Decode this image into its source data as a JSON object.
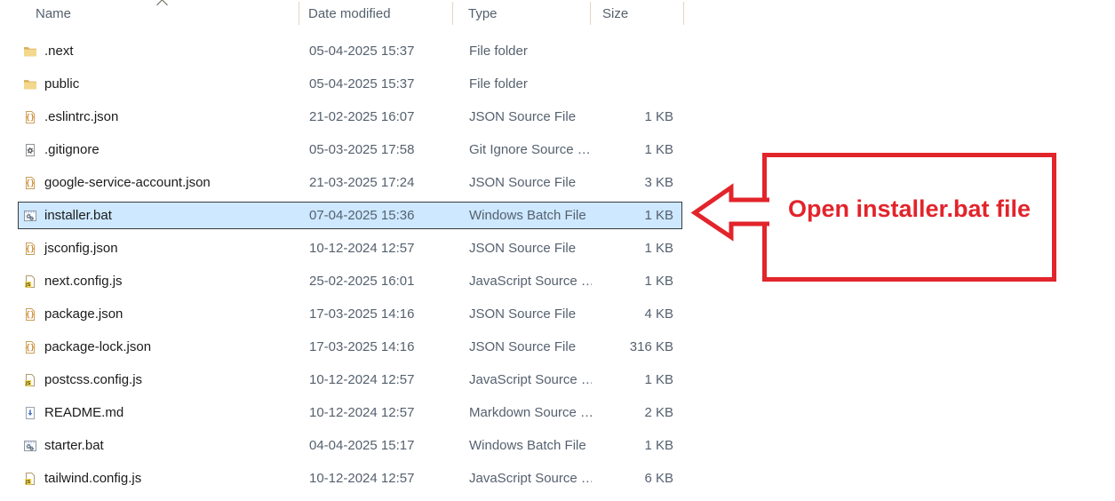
{
  "columns": {
    "name": "Name",
    "date_modified": "Date modified",
    "type": "Type",
    "size": "Size"
  },
  "sort": {
    "column": "Name",
    "direction": "ascending"
  },
  "files": [
    {
      "name": ".next",
      "date": "05-04-2025 15:37",
      "type": "File folder",
      "size": "",
      "icon": "folder-icon",
      "selected": false
    },
    {
      "name": "public",
      "date": "05-04-2025 15:37",
      "type": "File folder",
      "size": "",
      "icon": "folder-icon",
      "selected": false
    },
    {
      "name": ".eslintrc.json",
      "date": "21-02-2025 16:07",
      "type": "JSON Source File",
      "size": "1 KB",
      "icon": "json-icon",
      "selected": false
    },
    {
      "name": ".gitignore",
      "date": "05-03-2025 17:58",
      "type": "Git Ignore Source …",
      "size": "1 KB",
      "icon": "gitignore-icon",
      "selected": false
    },
    {
      "name": "google-service-account.json",
      "date": "21-03-2025 17:24",
      "type": "JSON Source File",
      "size": "3 KB",
      "icon": "json-icon",
      "selected": false
    },
    {
      "name": "installer.bat",
      "date": "07-04-2025 15:36",
      "type": "Windows Batch File",
      "size": "1 KB",
      "icon": "batch-icon",
      "selected": true
    },
    {
      "name": "jsconfig.json",
      "date": "10-12-2024 12:57",
      "type": "JSON Source File",
      "size": "1 KB",
      "icon": "json-icon",
      "selected": false
    },
    {
      "name": "next.config.js",
      "date": "25-02-2025 16:01",
      "type": "JavaScript Source …",
      "size": "1 KB",
      "icon": "js-icon",
      "selected": false
    },
    {
      "name": "package.json",
      "date": "17-03-2025 14:16",
      "type": "JSON Source File",
      "size": "4 KB",
      "icon": "json-icon",
      "selected": false
    },
    {
      "name": "package-lock.json",
      "date": "17-03-2025 14:16",
      "type": "JSON Source File",
      "size": "316 KB",
      "icon": "json-icon",
      "selected": false
    },
    {
      "name": "postcss.config.js",
      "date": "10-12-2024 12:57",
      "type": "JavaScript Source …",
      "size": "1 KB",
      "icon": "js-icon",
      "selected": false
    },
    {
      "name": "README.md",
      "date": "10-12-2024 12:57",
      "type": "Markdown Source …",
      "size": "2 KB",
      "icon": "markdown-icon",
      "selected": false
    },
    {
      "name": "starter.bat",
      "date": "04-04-2025 15:17",
      "type": "Windows Batch File",
      "size": "1 KB",
      "icon": "batch-icon",
      "selected": false
    },
    {
      "name": "tailwind.config.js",
      "date": "10-12-2024 12:57",
      "type": "JavaScript Source …",
      "size": "6 KB",
      "icon": "js-icon",
      "selected": false
    }
  ],
  "annotation": {
    "label": "Open installer.bat file",
    "target_file": "installer.bat",
    "arrow_direction": "left",
    "color": "#e2242b"
  },
  "colors": {
    "selection_fill": "#cde8ff",
    "selection_border": "#363b45",
    "text_primary": "#1b1b1b",
    "text_secondary": "#55616f",
    "header_separator": "#e3d5c0",
    "annotation_red": "#e2242b"
  }
}
